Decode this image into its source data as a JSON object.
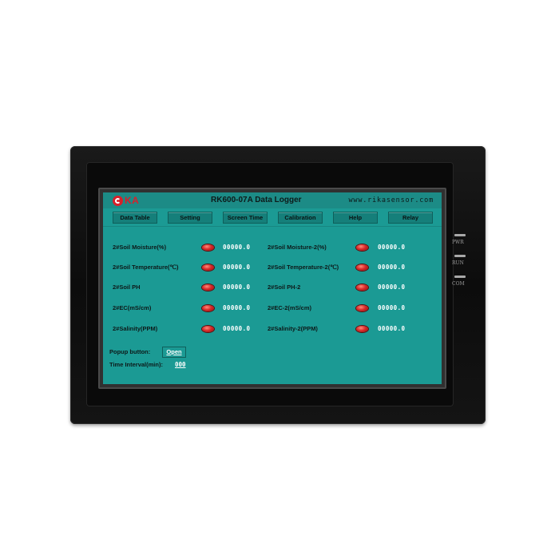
{
  "app": {
    "logo_text": "KA",
    "title": "RK600-07A Data Logger",
    "url": "www.rikasensor.com"
  },
  "tabs": [
    {
      "label": "Data Table"
    },
    {
      "label": "Setting"
    },
    {
      "label": "Screen Time"
    },
    {
      "label": "Calibration"
    },
    {
      "label": "Help"
    },
    {
      "label": "Relay"
    }
  ],
  "left_rows": [
    {
      "label": "2#Soil Moisture(%)",
      "value": "00000.0"
    },
    {
      "label": "2#Soil Temperature(℃)",
      "value": "00000.0"
    },
    {
      "label": "2#Soil PH",
      "value": "00000.0"
    },
    {
      "label": "2#EC(mS/cm)",
      "value": "00000.0"
    },
    {
      "label": "2#Salinity(PPM)",
      "value": "00000.0"
    }
  ],
  "right_rows": [
    {
      "label": "2#Soil Moisture-2(%)",
      "value": "00000.0"
    },
    {
      "label": "2#Soil Temperature-2(℃)",
      "value": "00000.0"
    },
    {
      "label": "2#Soil PH-2",
      "value": "00000.0"
    },
    {
      "label": "2#EC-2(mS/cm)",
      "value": "00000.0"
    },
    {
      "label": "2#Salinity-2(PPM)",
      "value": "00000.0"
    }
  ],
  "popup": {
    "label": "Popup button:",
    "button": "Open"
  },
  "interval": {
    "label": "Time Interval(min):",
    "value": "000"
  },
  "indicators": [
    {
      "label": "PWR"
    },
    {
      "label": "RUN"
    },
    {
      "label": "COM"
    }
  ],
  "colors": {
    "screen": "#1b9a94",
    "titlebar": "#1c8b86",
    "logo": "#d8202a",
    "led": "#d82828",
    "bezel": "#0a0a0a"
  }
}
